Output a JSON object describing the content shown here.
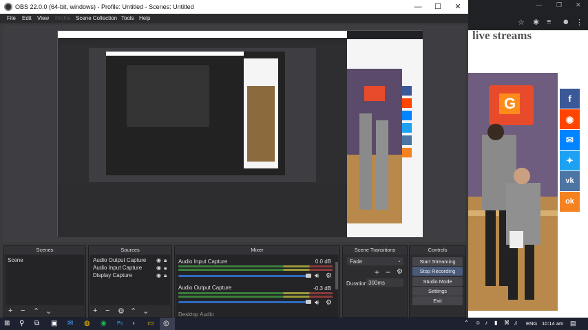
{
  "window": {
    "title": "OBS 22.0.0 (64-bit, windows) - Profile: Untitled - Scenes: Untitled",
    "minimize": "—",
    "maximize": "☐",
    "close": "✕"
  },
  "menu": [
    "File",
    "Edit",
    "View",
    "Profile",
    "Scene Collection",
    "Tools",
    "Help"
  ],
  "docks": {
    "scenes": {
      "title": "Scenes",
      "items": [
        "Scene"
      ]
    },
    "sources": {
      "title": "Sources",
      "items": [
        "Audio Output Capture",
        "Audio Input Capture",
        "Display Capture"
      ]
    },
    "mixer": {
      "title": "Mixer",
      "channels": [
        {
          "name": "Audio Input Capture",
          "db": "0.0 dB",
          "level": 0.68
        },
        {
          "name": "Audio Output Capture",
          "db": "-0.3 dB",
          "level": 0.68
        },
        {
          "name": "Desktop Audio",
          "db": "",
          "level": 0.0
        }
      ]
    },
    "transitions": {
      "title": "Scene Transitions",
      "type": "Fade",
      "duration_label": "Duration",
      "duration": "300ms"
    },
    "controls": {
      "title": "Controls",
      "buttons": [
        "Start Streaming",
        "Stop Recording",
        "Studio Mode",
        "Settings",
        "Exit"
      ]
    }
  },
  "page": {
    "heading": "live streams",
    "share_icons": [
      {
        "name": "facebook-icon",
        "glyph": "f",
        "color": "#3b5998"
      },
      {
        "name": "reddit-icon",
        "glyph": "◉",
        "color": "#ff4500"
      },
      {
        "name": "messenger-icon",
        "glyph": "✉",
        "color": "#0084ff"
      },
      {
        "name": "twitter-icon",
        "glyph": "🐦",
        "color": "#1da1f2"
      },
      {
        "name": "vk-icon",
        "glyph": "vk",
        "color": "#4c75a3"
      },
      {
        "name": "odnoklassniki-icon",
        "glyph": "ok",
        "color": "#f58220"
      }
    ]
  },
  "taskbar": {
    "language": "ENG",
    "time": "10:14 am"
  }
}
